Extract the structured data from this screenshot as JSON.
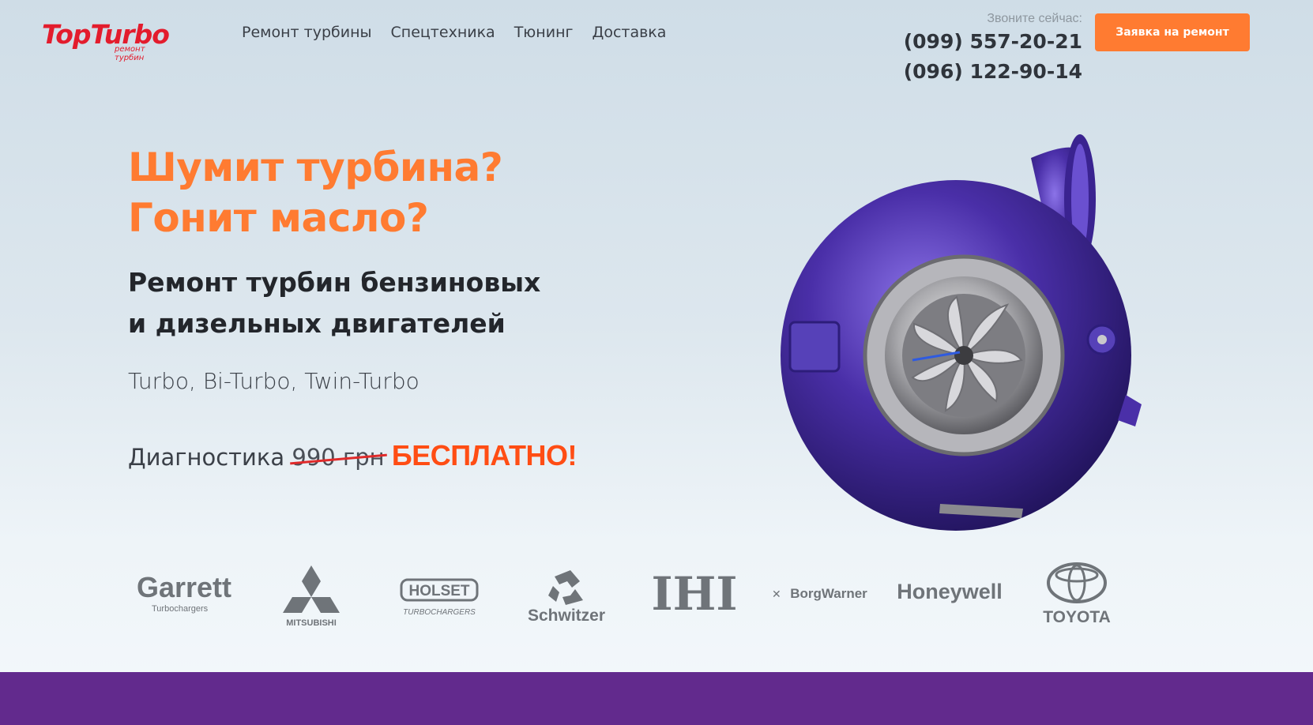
{
  "header": {
    "logo": {
      "name": "TopTurbo",
      "tagline": "ремонт турбин"
    },
    "nav": [
      "Ремонт турбины",
      "Спецтехника",
      "Тюнинг",
      "Доставка"
    ],
    "call_label": "Звоните сейчас:",
    "phones": [
      "(099) 557-20-21",
      "(096) 122-90-14"
    ],
    "cta_label": "Заявка на ремонт"
  },
  "hero": {
    "title_lines": [
      "Шумит турбина?",
      "Гонит масло?"
    ],
    "subtitle_lines": [
      "Ремонт турбин бензиновых",
      "и дизельных двигателей"
    ],
    "types": "Turbo, Bi-Turbo, Twin-Turbo",
    "diagnostics": {
      "label": "Диагностика",
      "old_price": "990 грн",
      "offer": "БЕСПЛАТНО!"
    }
  },
  "brands": [
    {
      "name": "Garrett",
      "sub": "Turbochargers"
    },
    {
      "name": "MITSUBISHI"
    },
    {
      "name": "HOLSET",
      "sub": "TURBOCHARGERS"
    },
    {
      "name": "Schwitzer"
    },
    {
      "name": "IHI"
    },
    {
      "name": "BorgWarner"
    },
    {
      "name": "Honeywell"
    },
    {
      "name": "TOYOTA"
    }
  ],
  "colors": {
    "accent": "#ff7b31",
    "logo_red": "#e31c2d",
    "offer_red": "#ff4d14",
    "footer_purple": "#622a8d",
    "turbo_purple": "#4a2fa8",
    "brand_gray": "#6f7479"
  }
}
